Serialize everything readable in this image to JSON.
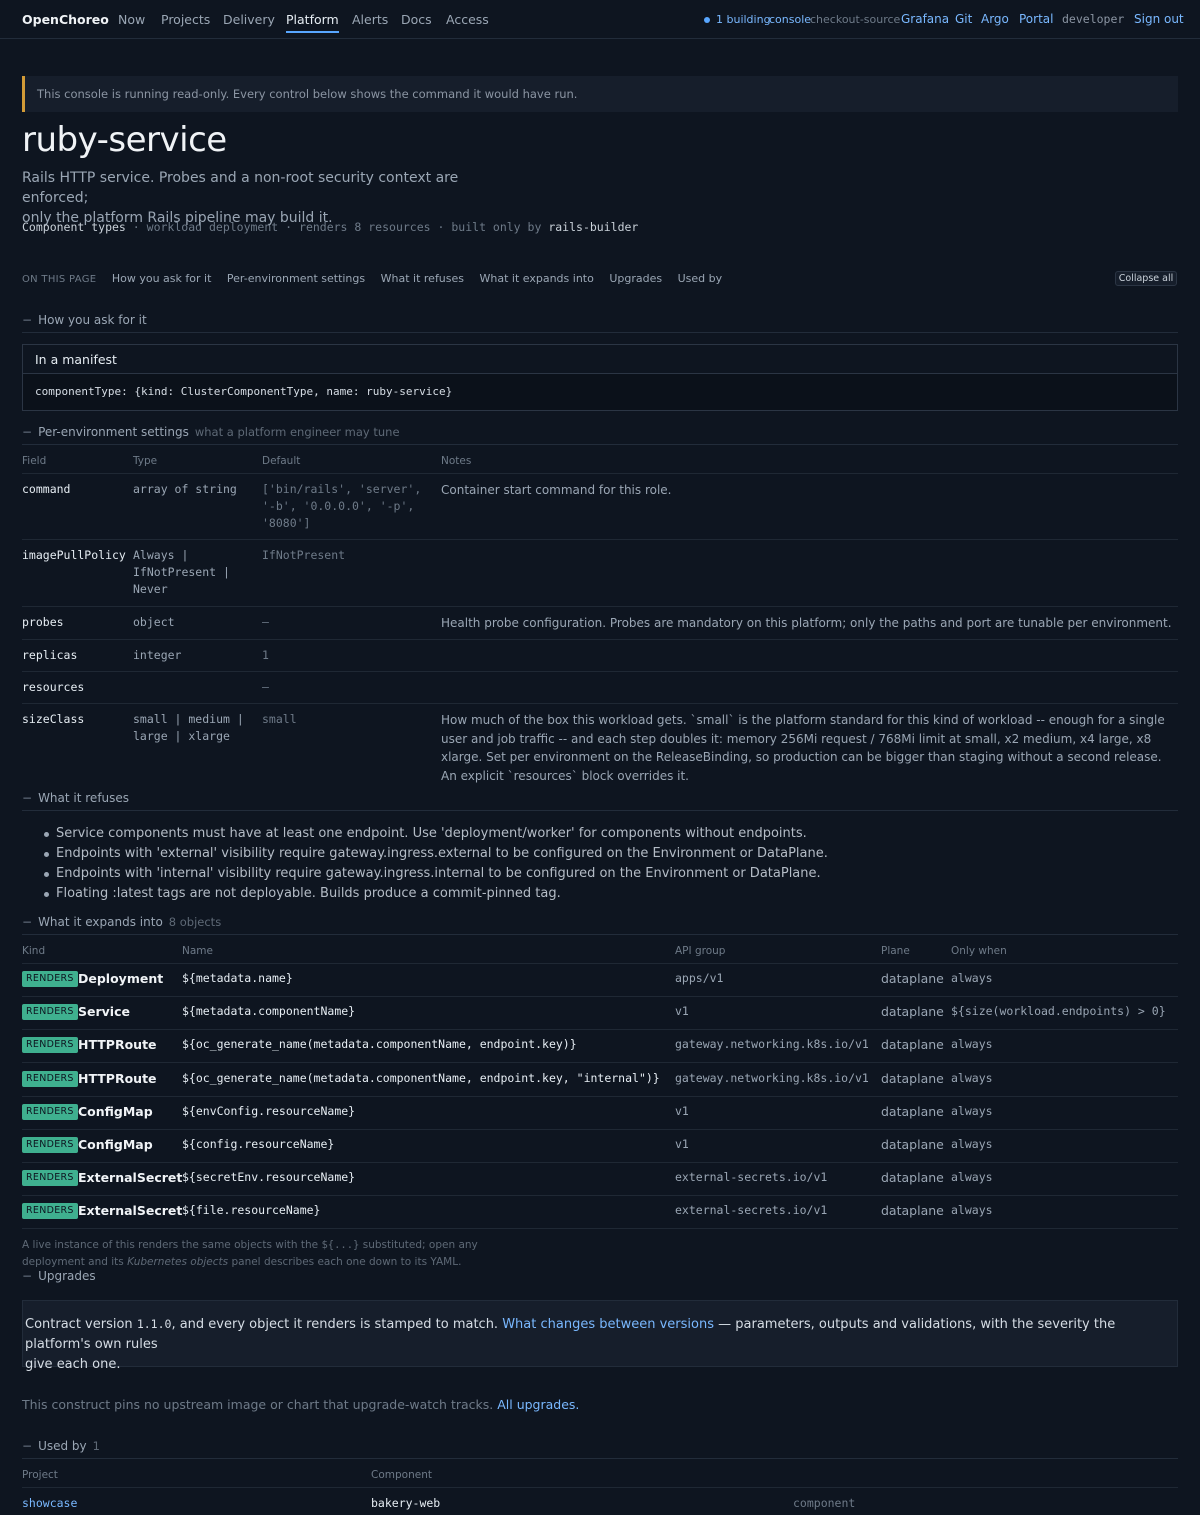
{
  "nav": {
    "brand": "OpenChoreo",
    "items": [
      "Now",
      "Projects",
      "Delivery",
      "Platform",
      "Alerts",
      "Docs",
      "Access"
    ],
    "active": "Platform",
    "status": "1 building",
    "console_label": "console",
    "console_target": "checkout-source",
    "links": [
      "Grafana",
      "Git",
      "Argo",
      "Portal"
    ],
    "user": "developer",
    "signout": "Sign out"
  },
  "notice": "This console is running read-only. Every control below shows the command it would have run.",
  "page": {
    "title": "ruby-service",
    "subtitle_1": "Rails HTTP service. Probes and a non-root security context are enforced;",
    "subtitle_2": "only the platform Rails pipeline may build it.",
    "meta_crumb": "Component types",
    "meta_kind": "workload deployment",
    "meta_renders": "renders 8 resources",
    "meta_built": "built only by",
    "meta_builder": "rails-builder"
  },
  "onpage": {
    "label": "ON THIS PAGE",
    "links": [
      "How you ask for it",
      "Per-environment settings",
      "What it refuses",
      "What it expands into",
      "Upgrades",
      "Used by"
    ],
    "collapse": "Collapse all"
  },
  "ask": {
    "heading": "How you ask for it",
    "manifest_title": "In a manifest",
    "manifest_code": "componentType: {kind: ClusterComponentType, name: ruby-service}"
  },
  "settings": {
    "heading": "Per-environment settings",
    "sub": "what a platform engineer may tune",
    "columns": [
      "Field",
      "Type",
      "Default",
      "Notes"
    ],
    "rows": [
      {
        "field": "command",
        "type": "array of string",
        "default": "['bin/rails', 'server', '-b', '0.0.0.0', '-p', '8080']",
        "notes": "Container start command for this role."
      },
      {
        "field": "imagePullPolicy",
        "type": "Always | IfNotPresent | Never",
        "default": "IfNotPresent",
        "notes": ""
      },
      {
        "field": "probes",
        "type": "object",
        "default": "—",
        "notes": "Health probe configuration. Probes are mandatory on this platform; only the paths and port are tunable per environment."
      },
      {
        "field": "replicas",
        "type": "integer",
        "default": "1",
        "notes": ""
      },
      {
        "field": "resources",
        "type": "",
        "default": "—",
        "notes": ""
      },
      {
        "field": "sizeClass",
        "type": "small | medium | large | xlarge",
        "default": "small",
        "notes": "How much of the box this workload gets. `small` is the platform standard for this kind of workload -- enough for a single user and job traffic -- and each step doubles it: memory 256Mi request / 768Mi limit at small, x2 medium, x4 large, x8 xlarge. Set per environment on the ReleaseBinding, so production can be bigger than staging without a second release. An explicit `resources` block overrides it."
      }
    ]
  },
  "refuses": {
    "heading": "What it refuses",
    "items": [
      "Service components must have at least one endpoint. Use 'deployment/worker' for components without endpoints.",
      "Endpoints with 'external' visibility require gateway.ingress.external to be configured on the Environment or DataPlane.",
      "Endpoints with 'internal' visibility require gateway.ingress.internal to be configured on the Environment or DataPlane.",
      "Floating :latest tags are not deployable. Builds produce a commit-pinned tag."
    ]
  },
  "expands": {
    "heading": "What it expands into",
    "sub": "8 objects",
    "columns": [
      "Kind",
      "Name",
      "API group",
      "Plane",
      "Only when"
    ],
    "badge": "RENDERS",
    "rows": [
      {
        "kind": "Deployment",
        "name": "${metadata.name}",
        "api": "apps/v1",
        "plane": "dataplane",
        "when": "always"
      },
      {
        "kind": "Service",
        "name": "${metadata.componentName}",
        "api": "v1",
        "plane": "dataplane",
        "when": "${size(workload.endpoints) > 0}"
      },
      {
        "kind": "HTTPRoute",
        "name": "${oc_generate_name(metadata.componentName, endpoint.key)}",
        "api": "gateway.networking.k8s.io/v1",
        "plane": "dataplane",
        "when": "always"
      },
      {
        "kind": "HTTPRoute",
        "name": "${oc_generate_name(metadata.componentName, endpoint.key, \"internal\")}",
        "api": "gateway.networking.k8s.io/v1",
        "plane": "dataplane",
        "when": "always"
      },
      {
        "kind": "ConfigMap",
        "name": "${envConfig.resourceName}",
        "api": "v1",
        "plane": "dataplane",
        "when": "always"
      },
      {
        "kind": "ConfigMap",
        "name": "${config.resourceName}",
        "api": "v1",
        "plane": "dataplane",
        "when": "always"
      },
      {
        "kind": "ExternalSecret",
        "name": "${secretEnv.resourceName}",
        "api": "external-secrets.io/v1",
        "plane": "dataplane",
        "when": "always"
      },
      {
        "kind": "ExternalSecret",
        "name": "${file.resourceName}",
        "api": "external-secrets.io/v1",
        "plane": "dataplane",
        "when": "always"
      }
    ],
    "foot_1": "A live instance of this renders the same objects with the",
    "foot_code": "${...}",
    "foot_2": "substituted; open any",
    "foot_3": "deployment and its",
    "foot_em": "Kubernetes objects",
    "foot_4": "panel describes each one down to its YAML."
  },
  "upgrades": {
    "heading": "Upgrades",
    "text_1": "Contract version",
    "version": "1.1.0",
    "text_2": ", and every object it renders is stamped to match.",
    "link": "What changes between versions",
    "text_3": "— parameters, outputs and validations, with the severity the platform's own rules",
    "text_4": "give each one.",
    "note": "This construct pins no upstream image or chart that upgrade-watch tracks.",
    "note_link": "All upgrades."
  },
  "usedby": {
    "heading": "Used by",
    "count": "1",
    "columns": [
      "Project",
      "Component"
    ],
    "rows": [
      {
        "project": "showcase",
        "component": "bakery-web",
        "type": "component"
      }
    ]
  },
  "colors": {
    "accent": "#58a6ff",
    "badge": "#3fb08f",
    "notice_border": "#d29b37"
  }
}
